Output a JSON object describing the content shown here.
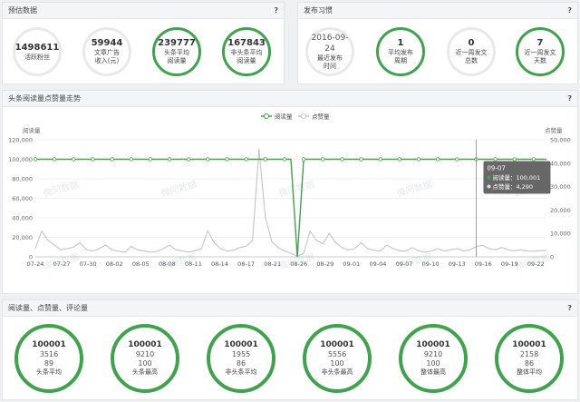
{
  "estimate": {
    "title": "预估数据",
    "help": "?",
    "circles": [
      {
        "value": "1498611",
        "label1": "活跃粉丝",
        "label2": "",
        "highlight": false
      },
      {
        "value": "59944",
        "label1": "文章广告",
        "label2": "收入(元)",
        "highlight": false
      },
      {
        "value": "239777",
        "label1": "头条平均",
        "label2": "阅读量",
        "highlight": true
      },
      {
        "value": "167843",
        "label1": "非头条平均",
        "label2": "阅读量",
        "highlight": true
      }
    ]
  },
  "habit": {
    "title": "发布习惯",
    "help": "?",
    "circles": [
      {
        "value": "2016-09-24",
        "label1": "最近发布",
        "label2": "时间",
        "highlight": false
      },
      {
        "value": "1",
        "label1": "平均发布",
        "label2": "周期",
        "highlight": true
      },
      {
        "value": "0",
        "label1": "近一周发文",
        "label2": "总数",
        "highlight": false
      },
      {
        "value": "7",
        "label1": "近一周发文",
        "label2": "天数",
        "highlight": true
      }
    ]
  },
  "trend": {
    "title": "头条阅读量点赞量走势",
    "help": "?",
    "watermark": "微问数据"
  },
  "stats": {
    "title": "阅读量、点赞量、评论量",
    "help": "?",
    "circles": [
      {
        "v1": "100001",
        "v2": "3516",
        "v3": "89",
        "label": "头条平均"
      },
      {
        "v1": "100001",
        "v2": "9210",
        "v3": "100",
        "label": "头条最高"
      },
      {
        "v1": "100001",
        "v2": "1955",
        "v3": "86",
        "label": "非头条平均"
      },
      {
        "v1": "100001",
        "v2": "5556",
        "v3": "100",
        "label": "非头条最高"
      },
      {
        "v1": "100001",
        "v2": "9210",
        "v3": "100",
        "label": "整体最高"
      },
      {
        "v1": "100001",
        "v2": "2158",
        "v3": "86",
        "label": "整体平均"
      }
    ]
  },
  "colors": {
    "green": "#3fa34d",
    "gray": "#c4c4c8",
    "tooltip_bg": "#5a5a5a"
  },
  "chart_data": {
    "type": "line",
    "ylabel": "阅读量",
    "y2label": "点赞量",
    "ylim": [
      0,
      120000
    ],
    "y2lim": [
      0,
      50000
    ],
    "yticks": [
      "0",
      "20,000",
      "40,000",
      "60,000",
      "80,000",
      "100,000",
      "120,000"
    ],
    "y2ticks": [
      "0",
      "10,000",
      "20,000",
      "30,000",
      "40,000",
      "50,000"
    ],
    "xticks": [
      "07-24",
      "07-27",
      "07-30",
      "08-02",
      "08-05",
      "08-08",
      "08-11",
      "08-14",
      "08-17",
      "08-21",
      "08-26",
      "08-29",
      "09-01",
      "09-04",
      "09-07",
      "09-10",
      "09-13",
      "09-16",
      "09-19",
      "09-22"
    ],
    "legend": [
      "阅读量",
      "点赞量"
    ],
    "legend_position": "top-center",
    "series": [
      {
        "name": "阅读量",
        "axis": "left",
        "values": [
          100001,
          100001,
          100001,
          100001,
          100001,
          100001,
          100001,
          100001,
          100001,
          100001,
          100001,
          100001,
          100001,
          100001,
          100001,
          100001,
          100001,
          100001,
          100001,
          100001,
          100001,
          100001,
          100001,
          100001,
          100001,
          100001,
          100001,
          100001,
          100001,
          100001,
          100001,
          100001,
          100001,
          100001,
          100001,
          100001,
          100001,
          100001,
          100001,
          100001,
          100001,
          100001,
          100001,
          100001,
          100001,
          100001,
          100001,
          100001,
          100001,
          100001,
          100001,
          100001,
          100001,
          100001,
          100001,
          100001,
          100001,
          100001,
          100001,
          100001,
          100001,
          100001,
          100001,
          100001,
          100001,
          100001,
          100001,
          100001,
          100001,
          100001,
          100001,
          100001,
          100001,
          100001,
          100001,
          100001,
          100001,
          100001,
          100001,
          100001,
          100001
        ]
      },
      {
        "name": "点赞量",
        "axis": "right",
        "values": [
          3500,
          11000,
          7000,
          5000,
          3000,
          3500,
          4200,
          6000,
          3000,
          2500,
          3500,
          5000,
          3000,
          2400,
          2000,
          4500,
          3000,
          2500,
          2000,
          2200,
          3500,
          5000,
          3000,
          2500,
          2000,
          2600,
          3500,
          11000,
          6000,
          3500,
          2500,
          2800,
          4000,
          4500,
          7000,
          46000,
          17000,
          6500,
          4000,
          2500,
          1500,
          300,
          1400,
          11000,
          7000,
          5500,
          10000,
          6000,
          4000,
          3000,
          3500,
          6000,
          3500,
          2800,
          2500,
          5000,
          3500,
          2600,
          2400,
          4000,
          2500,
          2000,
          2500,
          3500,
          2500,
          3000,
          3500,
          2500,
          3000,
          4290,
          5000,
          3500,
          3000,
          4000,
          3000,
          2600,
          3000,
          2500,
          2400,
          2600,
          2800
        ]
      }
    ],
    "tooltip": {
      "title": "09-07",
      "line1": "阅读量：100,001",
      "line2": "点赞量：4,290"
    }
  }
}
